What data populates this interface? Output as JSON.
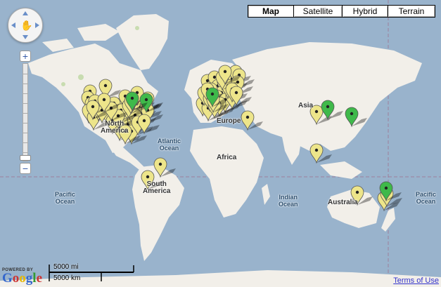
{
  "map_types": [
    {
      "label": "Map",
      "active": true
    },
    {
      "label": "Satellite",
      "active": false
    },
    {
      "label": "Hybrid",
      "active": false
    },
    {
      "label": "Terrain",
      "active": false
    }
  ],
  "labels": {
    "north_america_1": "North",
    "north_america_2": "America",
    "south_america_1": "South",
    "south_america_2": "America",
    "europe": "Europe",
    "africa": "Africa",
    "asia": "Asia",
    "australia": "Australia",
    "atlantic_1": "Atlantic",
    "atlantic_2": "Ocean",
    "pacific_w_1": "Pacific",
    "pacific_w_2": "Ocean",
    "pacific_e_1": "Pacific",
    "pacific_e_2": "Ocean",
    "indian_1": "Indian",
    "indian_2": "Ocean"
  },
  "scale": {
    "miles": "5000 mi",
    "km": "5000 km"
  },
  "footer": {
    "powered_by": "POWERED BY",
    "logo_text": "Google",
    "terms": "Terms of Use"
  },
  "zoom": {
    "plus": "+",
    "minus": "−"
  },
  "colors": {
    "ocean": "#99b3cc",
    "land": "#f2efe9",
    "pin_yellow": "#ede58a",
    "pin_green": "#3fb94a"
  },
  "markers": {
    "yellow_count": 81,
    "green_count": 6
  }
}
